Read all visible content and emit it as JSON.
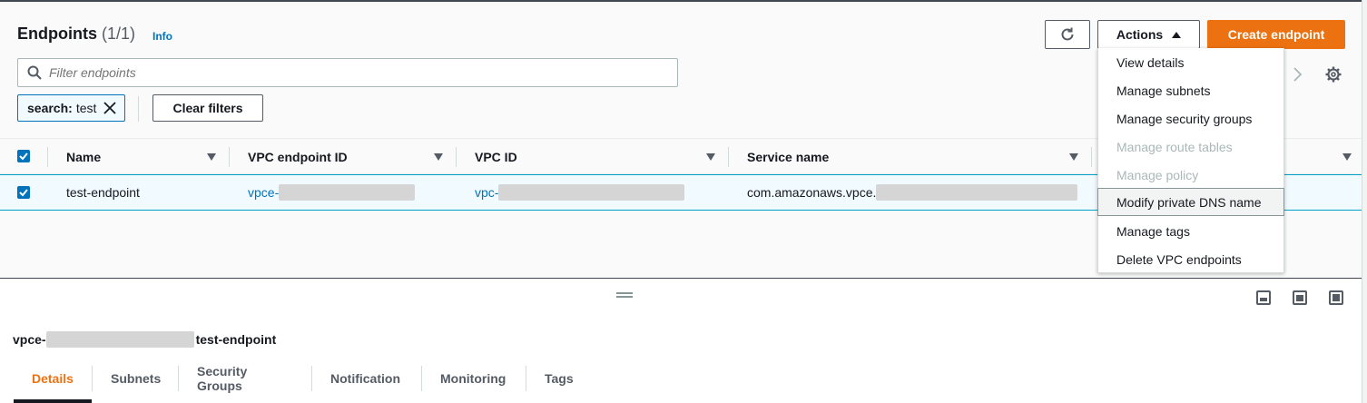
{
  "header": {
    "title": "Endpoints",
    "count": "(1/1)",
    "info": "Info"
  },
  "toolbar": {
    "actions_label": "Actions",
    "create_label": "Create endpoint"
  },
  "search": {
    "placeholder": "Filter endpoints"
  },
  "filter": {
    "token_key": "search:",
    "token_value": "test",
    "clear_label": "Clear filters"
  },
  "table": {
    "columns": [
      "Name",
      "VPC endpoint ID",
      "VPC ID",
      "Service name"
    ],
    "rows": [
      {
        "name": "test-endpoint",
        "endpoint_id_prefix": "vpce-",
        "vpc_id_prefix": "vpc-",
        "service_prefix": "com.amazonaws.vpce."
      }
    ]
  },
  "actions_menu": {
    "items": [
      {
        "label": "View details",
        "enabled": true
      },
      {
        "label": "Manage subnets",
        "enabled": true
      },
      {
        "label": "Manage security groups",
        "enabled": true
      },
      {
        "label": "Manage route tables",
        "enabled": false
      },
      {
        "label": "Manage policy",
        "enabled": false
      },
      {
        "label": "Modify private DNS name",
        "enabled": true
      },
      {
        "label": "Manage tags",
        "enabled": true
      },
      {
        "label": "Delete VPC endpoints",
        "enabled": true
      }
    ]
  },
  "details": {
    "id_prefix": "vpce-",
    "name": "test-endpoint",
    "tabs": [
      "Details",
      "Subnets",
      "Security Groups",
      "Notification",
      "Monitoring",
      "Tags"
    ]
  },
  "colors": {
    "accent": "#ec7211",
    "link": "#0073bb",
    "selected_row": "#f1faff"
  },
  "icons": [
    "refresh-icon",
    "caret-up-icon",
    "search-icon",
    "close-icon",
    "chevron-right-icon",
    "gear-icon",
    "sort-icon",
    "checkbox-icon",
    "drag-handle-icon",
    "pane-bottom-icon",
    "pane-side-icon",
    "pane-full-icon"
  ]
}
